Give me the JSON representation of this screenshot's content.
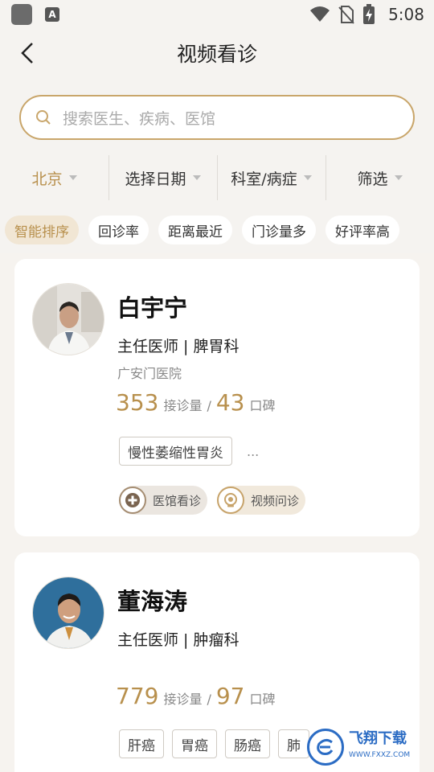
{
  "status_bar": {
    "time": "5:08",
    "a_label": "A"
  },
  "header": {
    "title": "视频看诊"
  },
  "search": {
    "placeholder": "搜索医生、疾病、医馆"
  },
  "filters": [
    {
      "label": "北京"
    },
    {
      "label": "选择日期"
    },
    {
      "label": "科室/病症"
    },
    {
      "label": "筛选"
    }
  ],
  "sorts": [
    "智能排序",
    "回诊率",
    "距离最近",
    "门诊量多",
    "好评率高"
  ],
  "doctors": [
    {
      "name": "白宇宁",
      "role": "主任医师 | 脾胃科",
      "hospital": "广安门医院",
      "consult_count": "353",
      "consult_label": "接诊量",
      "reputation": "43",
      "reputation_label": "口碑",
      "tags": [
        "慢性萎缩性胃炎"
      ],
      "more": "...",
      "services": [
        "医馆看诊",
        "视频问诊"
      ]
    },
    {
      "name": "董海涛",
      "role": "主任医师 | 肿瘤科",
      "consult_count": "779",
      "consult_label": "接诊量",
      "reputation": "97",
      "reputation_label": "口碑",
      "tags": [
        "肝癌",
        "胃癌",
        "肠癌",
        "肺"
      ]
    }
  ],
  "watermark": {
    "text": "飞翔下载",
    "url": "WWW.FXXZ.COM"
  },
  "colors": {
    "accent": "#b8904d",
    "search_border": "#c9a66b",
    "background": "#f6f3ef"
  }
}
